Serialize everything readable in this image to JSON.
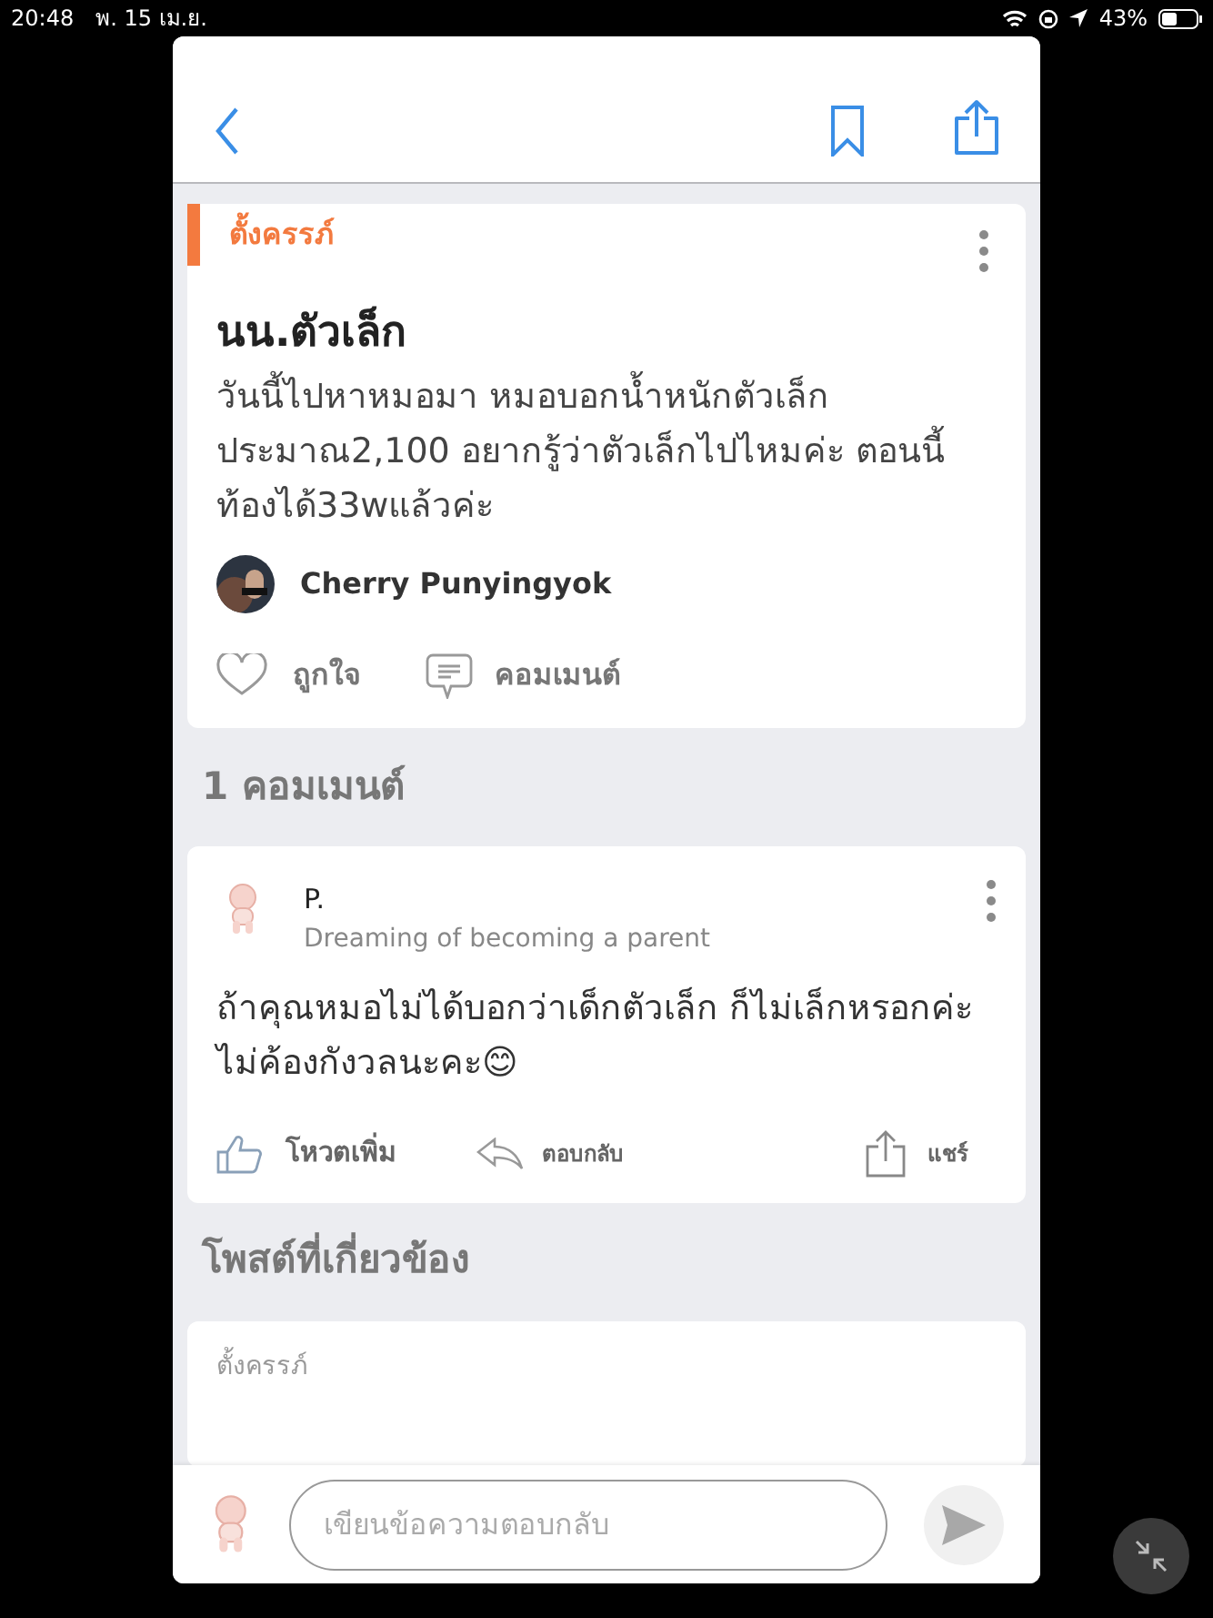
{
  "status_bar": {
    "time": "20:48",
    "date": "พ. 15 เม.ย.",
    "battery": "43%"
  },
  "post": {
    "category": "ตั้งครรภ์",
    "title": "นน.ตัวเล็ก",
    "body": "วันนี้ไปหาหมอมา หมอบอกน้ำหนักตัวเล็ก ประมาณ2,100 อยากรู้ว่าตัวเล็กไปไหมค่ะ ตอนนี้ท้องได้33wแล้วค่ะ",
    "author": "Cherry Punyingyok",
    "like_label": "ถูกใจ",
    "comment_label": "คอมเมนต์"
  },
  "comments_heading": "1 คอมเมนต์",
  "comments": [
    {
      "author": "P.",
      "tagline": "Dreaming of becoming a parent",
      "text": "ถ้าคุณหมอไม่ได้บอกว่าเด็กตัวเล็ก ก็ไม่เล็กหรอกค่ะ ไม่ค้องกังวลนะคะ😊",
      "vote_label": "โหวตเพิ่ม",
      "reply_label": "ตอบกลับ",
      "share_label": "แชร์"
    }
  ],
  "related_heading": "โพสต์ที่เกี่ยวข้อง",
  "related": [
    {
      "category": "ตั้งครรภ์"
    }
  ],
  "reply_box": {
    "placeholder": "เขียนข้อความตอบกลับ"
  }
}
